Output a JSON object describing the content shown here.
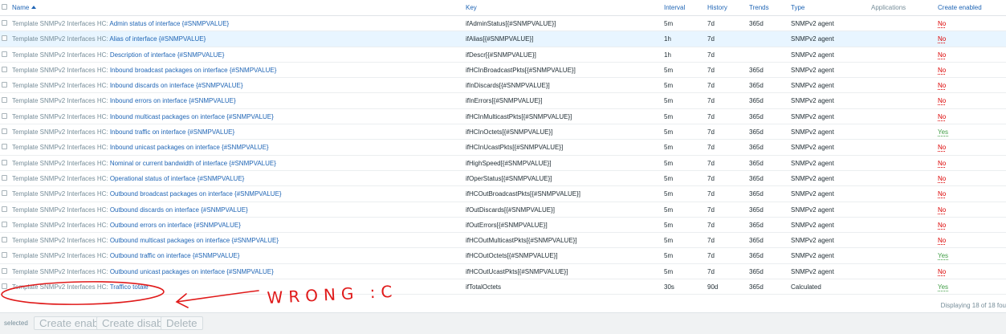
{
  "columns": {
    "name": "Name",
    "key": "Key",
    "interval": "Interval",
    "history": "History",
    "trends": "Trends",
    "type": "Type",
    "applications": "Applications",
    "create_enabled": "Create enabled"
  },
  "rows": [
    {
      "tpl": "Template SNMPv2 Interfaces HC",
      "name": "Admin status of interface {#SNMPVALUE}",
      "key": "ifAdminStatus[{#SNMPVALUE}]",
      "interval": "5m",
      "history": "7d",
      "trends": "365d",
      "type": "SNMPv2 agent",
      "status": "No"
    },
    {
      "tpl": "Template SNMPv2 Interfaces HC",
      "name": "Alias of interface {#SNMPVALUE}",
      "key": "ifAlias[{#SNMPVALUE}]",
      "interval": "1h",
      "history": "7d",
      "trends": "",
      "type": "SNMPv2 agent",
      "status": "No"
    },
    {
      "tpl": "Template SNMPv2 Interfaces HC",
      "name": "Description of interface {#SNMPVALUE}",
      "key": "ifDescr[{#SNMPVALUE}]",
      "interval": "1h",
      "history": "7d",
      "trends": "",
      "type": "SNMPv2 agent",
      "status": "No"
    },
    {
      "tpl": "Template SNMPv2 Interfaces HC",
      "name": "Inbound broadcast packages on interface {#SNMPVALUE}",
      "key": "ifHCInBroadcastPkts[{#SNMPVALUE}]",
      "interval": "5m",
      "history": "7d",
      "trends": "365d",
      "type": "SNMPv2 agent",
      "status": "No"
    },
    {
      "tpl": "Template SNMPv2 Interfaces HC",
      "name": "Inbound discards on interface {#SNMPVALUE}",
      "key": "ifInDiscards[{#SNMPVALUE}]",
      "interval": "5m",
      "history": "7d",
      "trends": "365d",
      "type": "SNMPv2 agent",
      "status": "No"
    },
    {
      "tpl": "Template SNMPv2 Interfaces HC",
      "name": "Inbound errors on interface {#SNMPVALUE}",
      "key": "ifInErrors[{#SNMPVALUE}]",
      "interval": "5m",
      "history": "7d",
      "trends": "365d",
      "type": "SNMPv2 agent",
      "status": "No"
    },
    {
      "tpl": "Template SNMPv2 Interfaces HC",
      "name": "Inbound multicast packages on interface {#SNMPVALUE}",
      "key": "ifHCInMulticastPkts[{#SNMPVALUE}]",
      "interval": "5m",
      "history": "7d",
      "trends": "365d",
      "type": "SNMPv2 agent",
      "status": "No"
    },
    {
      "tpl": "Template SNMPv2 Interfaces HC",
      "name": "Inbound traffic on interface {#SNMPVALUE}",
      "key": "ifHCInOctets[{#SNMPVALUE}]",
      "interval": "5m",
      "history": "7d",
      "trends": "365d",
      "type": "SNMPv2 agent",
      "status": "Yes"
    },
    {
      "tpl": "Template SNMPv2 Interfaces HC",
      "name": "Inbound unicast packages on interface {#SNMPVALUE}",
      "key": "ifHCInUcastPkts[{#SNMPVALUE}]",
      "interval": "5m",
      "history": "7d",
      "trends": "365d",
      "type": "SNMPv2 agent",
      "status": "No"
    },
    {
      "tpl": "Template SNMPv2 Interfaces HC",
      "name": "Nominal or current bandwidth of interface {#SNMPVALUE}",
      "key": "ifHighSpeed[{#SNMPVALUE}]",
      "interval": "5m",
      "history": "7d",
      "trends": "365d",
      "type": "SNMPv2 agent",
      "status": "No"
    },
    {
      "tpl": "Template SNMPv2 Interfaces HC",
      "name": "Operational status of interface {#SNMPVALUE}",
      "key": "ifOperStatus[{#SNMPVALUE}]",
      "interval": "5m",
      "history": "7d",
      "trends": "365d",
      "type": "SNMPv2 agent",
      "status": "No"
    },
    {
      "tpl": "Template SNMPv2 Interfaces HC",
      "name": "Outbound broadcast packages on interface {#SNMPVALUE}",
      "key": "ifHCOutBroadcastPkts[{#SNMPVALUE}]",
      "interval": "5m",
      "history": "7d",
      "trends": "365d",
      "type": "SNMPv2 agent",
      "status": "No"
    },
    {
      "tpl": "Template SNMPv2 Interfaces HC",
      "name": "Outbound discards on interface {#SNMPVALUE}",
      "key": "ifOutDiscards[{#SNMPVALUE}]",
      "interval": "5m",
      "history": "7d",
      "trends": "365d",
      "type": "SNMPv2 agent",
      "status": "No"
    },
    {
      "tpl": "Template SNMPv2 Interfaces HC",
      "name": "Outbound errors on interface {#SNMPVALUE}",
      "key": "ifOutErrors[{#SNMPVALUE}]",
      "interval": "5m",
      "history": "7d",
      "trends": "365d",
      "type": "SNMPv2 agent",
      "status": "No"
    },
    {
      "tpl": "Template SNMPv2 Interfaces HC",
      "name": "Outbound multicast packages on interface {#SNMPVALUE}",
      "key": "ifHCOutMulticastPkts[{#SNMPVALUE}]",
      "interval": "5m",
      "history": "7d",
      "trends": "365d",
      "type": "SNMPv2 agent",
      "status": "No"
    },
    {
      "tpl": "Template SNMPv2 Interfaces HC",
      "name": "Outbound traffic on interface {#SNMPVALUE}",
      "key": "ifHCOutOctets[{#SNMPVALUE}]",
      "interval": "5m",
      "history": "7d",
      "trends": "365d",
      "type": "SNMPv2 agent",
      "status": "Yes"
    },
    {
      "tpl": "Template SNMPv2 Interfaces HC",
      "name": "Outbound unicast packages on interface {#SNMPVALUE}",
      "key": "ifHCOutUcastPkts[{#SNMPVALUE}]",
      "interval": "5m",
      "history": "7d",
      "trends": "365d",
      "type": "SNMPv2 agent",
      "status": "No"
    },
    {
      "tpl": "Template SNMPv2 Interfaces HC",
      "name": "Traffico totale",
      "key": "ifTotalOctets",
      "interval": "30s",
      "history": "90d",
      "trends": "365d",
      "type": "Calculated",
      "status": "Yes"
    }
  ],
  "highlighted_row": 1,
  "footer": {
    "displaying": "Displaying 18 of 18 fou"
  },
  "actions": {
    "selected": "selected",
    "create_enabled": "Create enabled",
    "create_disabled": "Create disabled",
    "delete": "Delete"
  },
  "annotation": {
    "text": "WRONG :C",
    "color": "#e01a1a"
  },
  "colors": {
    "link": "#1f65b5",
    "template": "#768d99",
    "no": "#dc0000",
    "yes": "#429e47",
    "highlight": "#e8f5ff"
  }
}
